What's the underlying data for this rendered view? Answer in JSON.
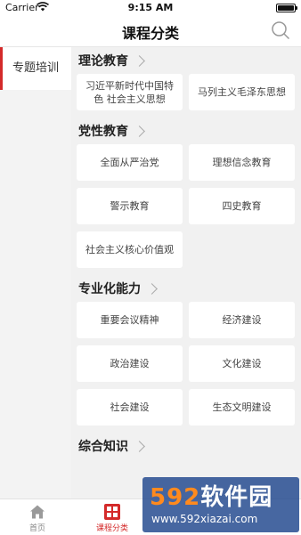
{
  "status_bar": {
    "carrier": "Carrier",
    "time": "9:15 AM"
  },
  "header": {
    "title": "课程分类"
  },
  "sidebar": {
    "items": [
      {
        "label": "专题培训",
        "selected": true
      }
    ]
  },
  "sections": [
    {
      "title": "理论教育",
      "tags": [
        "习近平新时代中国特色 社会主义思想",
        "马列主义毛泽东思想"
      ]
    },
    {
      "title": "党性教育",
      "tags": [
        "全面从严治党",
        "理想信念教育",
        "警示教育",
        "四史教育",
        "社会主义核心价值观"
      ]
    },
    {
      "title": "专业化能力",
      "tags": [
        "重要会议精神",
        "经济建设",
        "政治建设",
        "文化建设",
        "社会建设",
        "生态文明建设"
      ]
    },
    {
      "title": "综合知识",
      "tags": []
    }
  ],
  "tab_bar": {
    "home": {
      "label": "首页",
      "icon": "home-icon"
    },
    "categories": {
      "label": "课程分类",
      "icon": "grid-icon",
      "active": true
    }
  },
  "watermark": {
    "brand_num": "592",
    "brand_text": "软件园",
    "url": "www.592xiazai.com"
  },
  "colors": {
    "accent": "#d42a2a",
    "background": "#f1f1f1",
    "card": "#ffffff"
  }
}
